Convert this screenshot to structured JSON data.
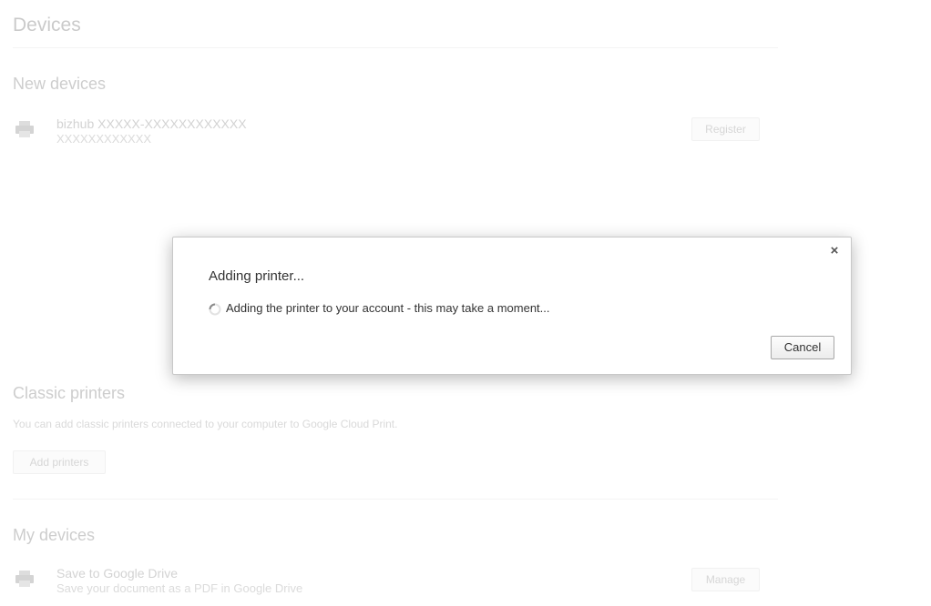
{
  "page": {
    "title": "Devices"
  },
  "new_devices": {
    "heading": "New devices",
    "device": {
      "name": "bizhub XXXXX-XXXXXXXXXXXX",
      "sub": "XXXXXXXXXXXX",
      "icon": "printer-icon",
      "button_label": "Register"
    }
  },
  "classic_printers": {
    "heading": "Classic printers",
    "description": "You can add classic printers connected to your computer to Google Cloud Print.",
    "button_label": "Add printers"
  },
  "my_devices": {
    "heading": "My devices",
    "device": {
      "name": "Save to Google Drive",
      "sub": "Save your document as a PDF in Google Drive",
      "icon": "printer-icon",
      "button_label": "Manage"
    }
  },
  "dialog": {
    "title": "Adding printer...",
    "message": "Adding the printer to your account - this may take a moment...",
    "cancel_label": "Cancel",
    "close_glyph": "×",
    "spinner_icon": "spinner-icon"
  }
}
